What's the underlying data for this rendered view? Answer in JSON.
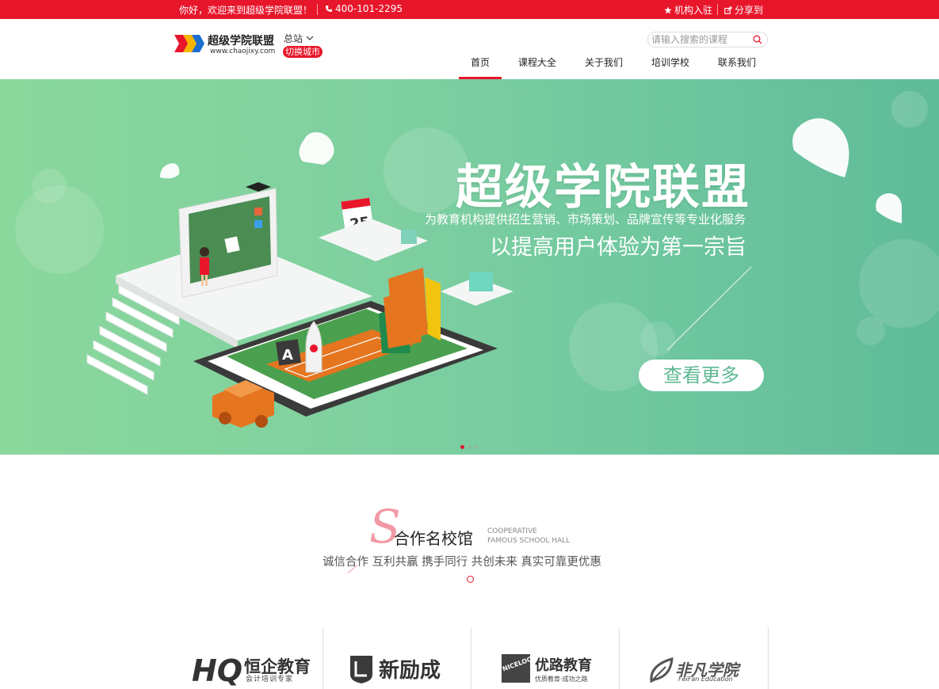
{
  "topbar": {
    "welcome": "你好，欢迎来到超级学院联盟！",
    "phone": "400-101-2295",
    "join": "机构入驻",
    "share": "分享到"
  },
  "header": {
    "logo_name": "超级学院联盟",
    "logo_url": "www.chaojixy.com",
    "site": "总站",
    "switch_city": "切换城市",
    "search_placeholder": "请输入搜索的课程"
  },
  "nav": {
    "items": [
      {
        "label": "首页",
        "active": true
      },
      {
        "label": "课程大全",
        "active": false
      },
      {
        "label": "关于我们",
        "active": false
      },
      {
        "label": "培训学校",
        "active": false
      },
      {
        "label": "联系我们",
        "active": false
      }
    ]
  },
  "banner": {
    "title": "超级学院联盟",
    "subtitle1": "为教育机构提供招生营销、市场策划、品牌宣传等专业化服务",
    "subtitle2": "以提高用户体验为第一宗旨",
    "more_button": "查看更多",
    "slide_count": 3,
    "active_slide": 1,
    "calendar_day": "25",
    "colors": {
      "start": "#8ad89c",
      "end": "#5fbb98"
    }
  },
  "section": {
    "letter": "S",
    "title": "合作名校馆",
    "en_line1": "COOPERATIVE",
    "en_line2": "FAMOUS SCHOOL HALL",
    "description": "诚信合作 互利共赢 携手同行 共创未来 真实可靠更优惠"
  },
  "partners": [
    {
      "name": "恒企教育",
      "sub": "会计培训专家",
      "mark": "HQ"
    },
    {
      "name": "新励成",
      "sub": "",
      "mark": ""
    },
    {
      "name": "优路教育",
      "sub": "优质教育·成功之路",
      "mark": "NICELOO"
    },
    {
      "name": "非凡学院",
      "sub": "FeiFan Education",
      "mark": ""
    }
  ],
  "colors": {
    "brand_red": "#e8162b"
  }
}
